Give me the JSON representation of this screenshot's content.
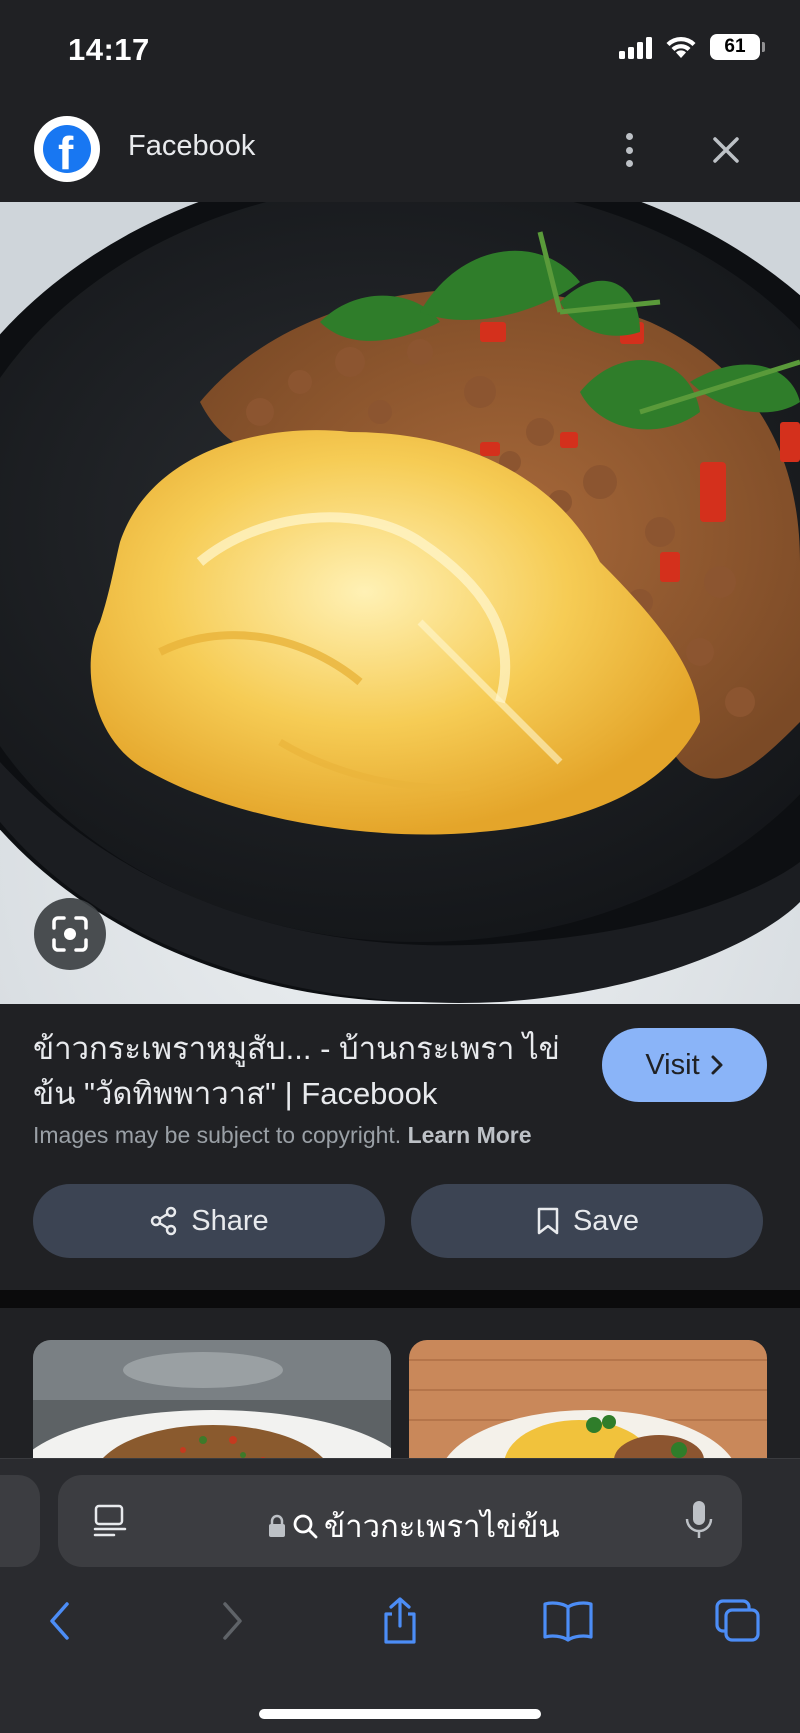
{
  "status": {
    "time": "14:17",
    "battery": "61"
  },
  "header": {
    "title": "Facebook"
  },
  "result": {
    "title": "ข้าวกระเพราหมูสับ... - บ้านกระเพรา ไข่ข้น \"วัดทิพพาวาส\" | Facebook",
    "visit_label": "Visit",
    "copyright_text": "Images may be subject to copyright.",
    "learn_more": "Learn More",
    "share_label": "Share",
    "save_label": "Save"
  },
  "browser": {
    "address": "ข้าวกะเพราไข่ข้น"
  },
  "colors": {
    "accent": "#8ab4f8",
    "background": "#202124",
    "button": "#3c4453",
    "facebook": "#1877f2"
  },
  "icons": [
    "facebook-logo",
    "more-vert-icon",
    "close-icon",
    "lens-icon",
    "chevron-right-icon",
    "share-icon",
    "bookmark-icon",
    "reader-icon",
    "lock-icon",
    "search-icon",
    "mic-icon",
    "back-icon",
    "forward-icon",
    "share-out-icon",
    "book-icon",
    "tabs-icon"
  ]
}
